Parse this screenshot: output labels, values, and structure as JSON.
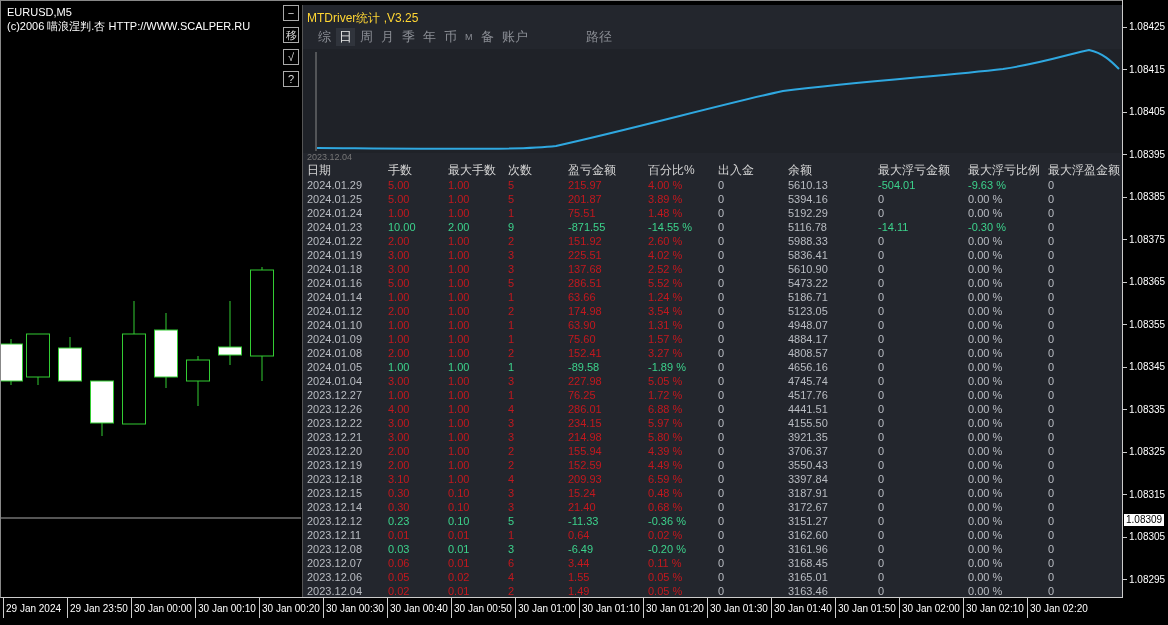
{
  "chart_header": {
    "symbol": "EURUSD,M5",
    "copyright": "(c)2006 喵浪涅判.杏 HTTP://WWW.SCALPER.RU"
  },
  "side_buttons": [
    "−",
    "移",
    "√",
    "?"
  ],
  "panel": {
    "title": "MTDriver统计 ,V3.25",
    "tabs": [
      {
        "label": "综",
        "selected": false,
        "kind": "tab"
      },
      {
        "label": "日",
        "selected": true,
        "kind": "tab"
      },
      {
        "label": "周",
        "selected": false,
        "kind": "tab"
      },
      {
        "label": "月",
        "selected": false,
        "kind": "tab"
      },
      {
        "label": "季",
        "selected": false,
        "kind": "tab"
      },
      {
        "label": "年",
        "selected": false,
        "kind": "tab"
      },
      {
        "label": "币",
        "selected": false,
        "kind": "tab"
      },
      {
        "label": "M",
        "selected": false,
        "kind": "small"
      },
      {
        "label": "备",
        "selected": false,
        "kind": "tab"
      },
      {
        "label": "账户",
        "selected": false,
        "kind": "tab"
      },
      {
        "label": "路径",
        "selected": false,
        "kind": "far"
      }
    ],
    "equity_start_date": "2023.12.04",
    "columns": [
      "日期",
      "手数",
      "最大手数",
      "次数",
      "盈亏金额",
      "百分比%",
      "出入金",
      "余额",
      "最大浮亏金额",
      "最大浮亏比例",
      "最大浮盈金额"
    ],
    "rows": [
      {
        "cells": [
          "2024.01.29",
          "5.00",
          "1.00",
          "5",
          "215.97",
          "4.00 %",
          "0",
          "5610.13",
          "-504.01",
          "-9.63 %",
          "0"
        ],
        "profit": true,
        "drawdown": true
      },
      {
        "cells": [
          "2024.01.25",
          "5.00",
          "1.00",
          "5",
          "201.87",
          "3.89 %",
          "0",
          "5394.16",
          "0",
          "0.00 %",
          "0"
        ],
        "profit": true,
        "drawdown": false
      },
      {
        "cells": [
          "2024.01.24",
          "1.00",
          "1.00",
          "1",
          "75.51",
          "1.48 %",
          "0",
          "5192.29",
          "0",
          "0.00 %",
          "0"
        ],
        "profit": true,
        "drawdown": false
      },
      {
        "cells": [
          "2024.01.23",
          "10.00",
          "2.00",
          "9",
          "-871.55",
          "-14.55 %",
          "0",
          "5116.78",
          "-14.11",
          "-0.30 %",
          "0"
        ],
        "profit": false,
        "drawdown": true
      },
      {
        "cells": [
          "2024.01.22",
          "2.00",
          "1.00",
          "2",
          "151.92",
          "2.60 %",
          "0",
          "5988.33",
          "0",
          "0.00 %",
          "0"
        ],
        "profit": true,
        "drawdown": false
      },
      {
        "cells": [
          "2024.01.19",
          "3.00",
          "1.00",
          "3",
          "225.51",
          "4.02 %",
          "0",
          "5836.41",
          "0",
          "0.00 %",
          "0"
        ],
        "profit": true,
        "drawdown": false
      },
      {
        "cells": [
          "2024.01.18",
          "3.00",
          "1.00",
          "3",
          "137.68",
          "2.52 %",
          "0",
          "5610.90",
          "0",
          "0.00 %",
          "0"
        ],
        "profit": true,
        "drawdown": false
      },
      {
        "cells": [
          "2024.01.16",
          "5.00",
          "1.00",
          "5",
          "286.51",
          "5.52 %",
          "0",
          "5473.22",
          "0",
          "0.00 %",
          "0"
        ],
        "profit": true,
        "drawdown": false
      },
      {
        "cells": [
          "2024.01.14",
          "1.00",
          "1.00",
          "1",
          "63.66",
          "1.24 %",
          "0",
          "5186.71",
          "0",
          "0.00 %",
          "0"
        ],
        "profit": true,
        "drawdown": false
      },
      {
        "cells": [
          "2024.01.12",
          "2.00",
          "1.00",
          "2",
          "174.98",
          "3.54 %",
          "0",
          "5123.05",
          "0",
          "0.00 %",
          "0"
        ],
        "profit": true,
        "drawdown": false
      },
      {
        "cells": [
          "2024.01.10",
          "1.00",
          "1.00",
          "1",
          "63.90",
          "1.31 %",
          "0",
          "4948.07",
          "0",
          "0.00 %",
          "0"
        ],
        "profit": true,
        "drawdown": false
      },
      {
        "cells": [
          "2024.01.09",
          "1.00",
          "1.00",
          "1",
          "75.60",
          "1.57 %",
          "0",
          "4884.17",
          "0",
          "0.00 %",
          "0"
        ],
        "profit": true,
        "drawdown": false
      },
      {
        "cells": [
          "2024.01.08",
          "2.00",
          "1.00",
          "2",
          "152.41",
          "3.27 %",
          "0",
          "4808.57",
          "0",
          "0.00 %",
          "0"
        ],
        "profit": true,
        "drawdown": false
      },
      {
        "cells": [
          "2024.01.05",
          "1.00",
          "1.00",
          "1",
          "-89.58",
          "-1.89 %",
          "0",
          "4656.16",
          "0",
          "0.00 %",
          "0"
        ],
        "profit": false,
        "drawdown": false
      },
      {
        "cells": [
          "2024.01.04",
          "3.00",
          "1.00",
          "3",
          "227.98",
          "5.05 %",
          "0",
          "4745.74",
          "0",
          "0.00 %",
          "0"
        ],
        "profit": true,
        "drawdown": false
      },
      {
        "cells": [
          "2023.12.27",
          "1.00",
          "1.00",
          "1",
          "76.25",
          "1.72 %",
          "0",
          "4517.76",
          "0",
          "0.00 %",
          "0"
        ],
        "profit": true,
        "drawdown": false
      },
      {
        "cells": [
          "2023.12.26",
          "4.00",
          "1.00",
          "4",
          "286.01",
          "6.88 %",
          "0",
          "4441.51",
          "0",
          "0.00 %",
          "0"
        ],
        "profit": true,
        "drawdown": false
      },
      {
        "cells": [
          "2023.12.22",
          "3.00",
          "1.00",
          "3",
          "234.15",
          "5.97 %",
          "0",
          "4155.50",
          "0",
          "0.00 %",
          "0"
        ],
        "profit": true,
        "drawdown": false
      },
      {
        "cells": [
          "2023.12.21",
          "3.00",
          "1.00",
          "3",
          "214.98",
          "5.80 %",
          "0",
          "3921.35",
          "0",
          "0.00 %",
          "0"
        ],
        "profit": true,
        "drawdown": false
      },
      {
        "cells": [
          "2023.12.20",
          "2.00",
          "1.00",
          "2",
          "155.94",
          "4.39 %",
          "0",
          "3706.37",
          "0",
          "0.00 %",
          "0"
        ],
        "profit": true,
        "drawdown": false
      },
      {
        "cells": [
          "2023.12.19",
          "2.00",
          "1.00",
          "2",
          "152.59",
          "4.49 %",
          "0",
          "3550.43",
          "0",
          "0.00 %",
          "0"
        ],
        "profit": true,
        "drawdown": false
      },
      {
        "cells": [
          "2023.12.18",
          "3.10",
          "1.00",
          "4",
          "209.93",
          "6.59 %",
          "0",
          "3397.84",
          "0",
          "0.00 %",
          "0"
        ],
        "profit": true,
        "drawdown": false
      },
      {
        "cells": [
          "2023.12.15",
          "0.30",
          "0.10",
          "3",
          "15.24",
          "0.48 %",
          "0",
          "3187.91",
          "0",
          "0.00 %",
          "0"
        ],
        "profit": true,
        "drawdown": false
      },
      {
        "cells": [
          "2023.12.14",
          "0.30",
          "0.10",
          "3",
          "21.40",
          "0.68 %",
          "0",
          "3172.67",
          "0",
          "0.00 %",
          "0"
        ],
        "profit": true,
        "drawdown": false
      },
      {
        "cells": [
          "2023.12.12",
          "0.23",
          "0.10",
          "5",
          "-11.33",
          "-0.36 %",
          "0",
          "3151.27",
          "0",
          "0.00 %",
          "0"
        ],
        "profit": false,
        "drawdown": false
      },
      {
        "cells": [
          "2023.12.11",
          "0.01",
          "0.01",
          "1",
          "0.64",
          "0.02 %",
          "0",
          "3162.60",
          "0",
          "0.00 %",
          "0"
        ],
        "profit": true,
        "drawdown": false
      },
      {
        "cells": [
          "2023.12.08",
          "0.03",
          "0.01",
          "3",
          "-6.49",
          "-0.20 %",
          "0",
          "3161.96",
          "0",
          "0.00 %",
          "0"
        ],
        "profit": false,
        "drawdown": false
      },
      {
        "cells": [
          "2023.12.07",
          "0.06",
          "0.01",
          "6",
          "3.44",
          "0.11 %",
          "0",
          "3168.45",
          "0",
          "0.00 %",
          "0"
        ],
        "profit": true,
        "drawdown": false
      },
      {
        "cells": [
          "2023.12.06",
          "0.05",
          "0.02",
          "4",
          "1.55",
          "0.05 %",
          "0",
          "3165.01",
          "0",
          "0.00 %",
          "0"
        ],
        "profit": true,
        "drawdown": false
      },
      {
        "cells": [
          "2023.12.04",
          "0.02",
          "0.01",
          "2",
          "1.49",
          "0.05 %",
          "0",
          "3163.46",
          "0",
          "0.00 %",
          "0"
        ],
        "profit": true,
        "drawdown": false
      }
    ]
  },
  "price_axis": {
    "ticks": [
      "1.08425",
      "1.08415",
      "1.08405",
      "1.08395",
      "1.08385",
      "1.08375",
      "1.08365",
      "1.08355",
      "1.08345",
      "1.08335",
      "1.08325",
      "1.08315",
      "1.08305",
      "1.08295"
    ],
    "current_price": "1.08309"
  },
  "time_axis": [
    "29 Jan 2024",
    "29 Jan 23:50",
    "30 Jan 00:00",
    "30 Jan 00:10",
    "30 Jan 00:20",
    "30 Jan 00:30",
    "30 Jan 00:40",
    "30 Jan 00:50",
    "30 Jan 01:00",
    "30 Jan 01:10",
    "30 Jan 01:20",
    "30 Jan 01:30",
    "30 Jan 01:40",
    "30 Jan 01:50",
    "30 Jan 02:00",
    "30 Jan 02:10",
    "30 Jan 02:20"
  ]
}
